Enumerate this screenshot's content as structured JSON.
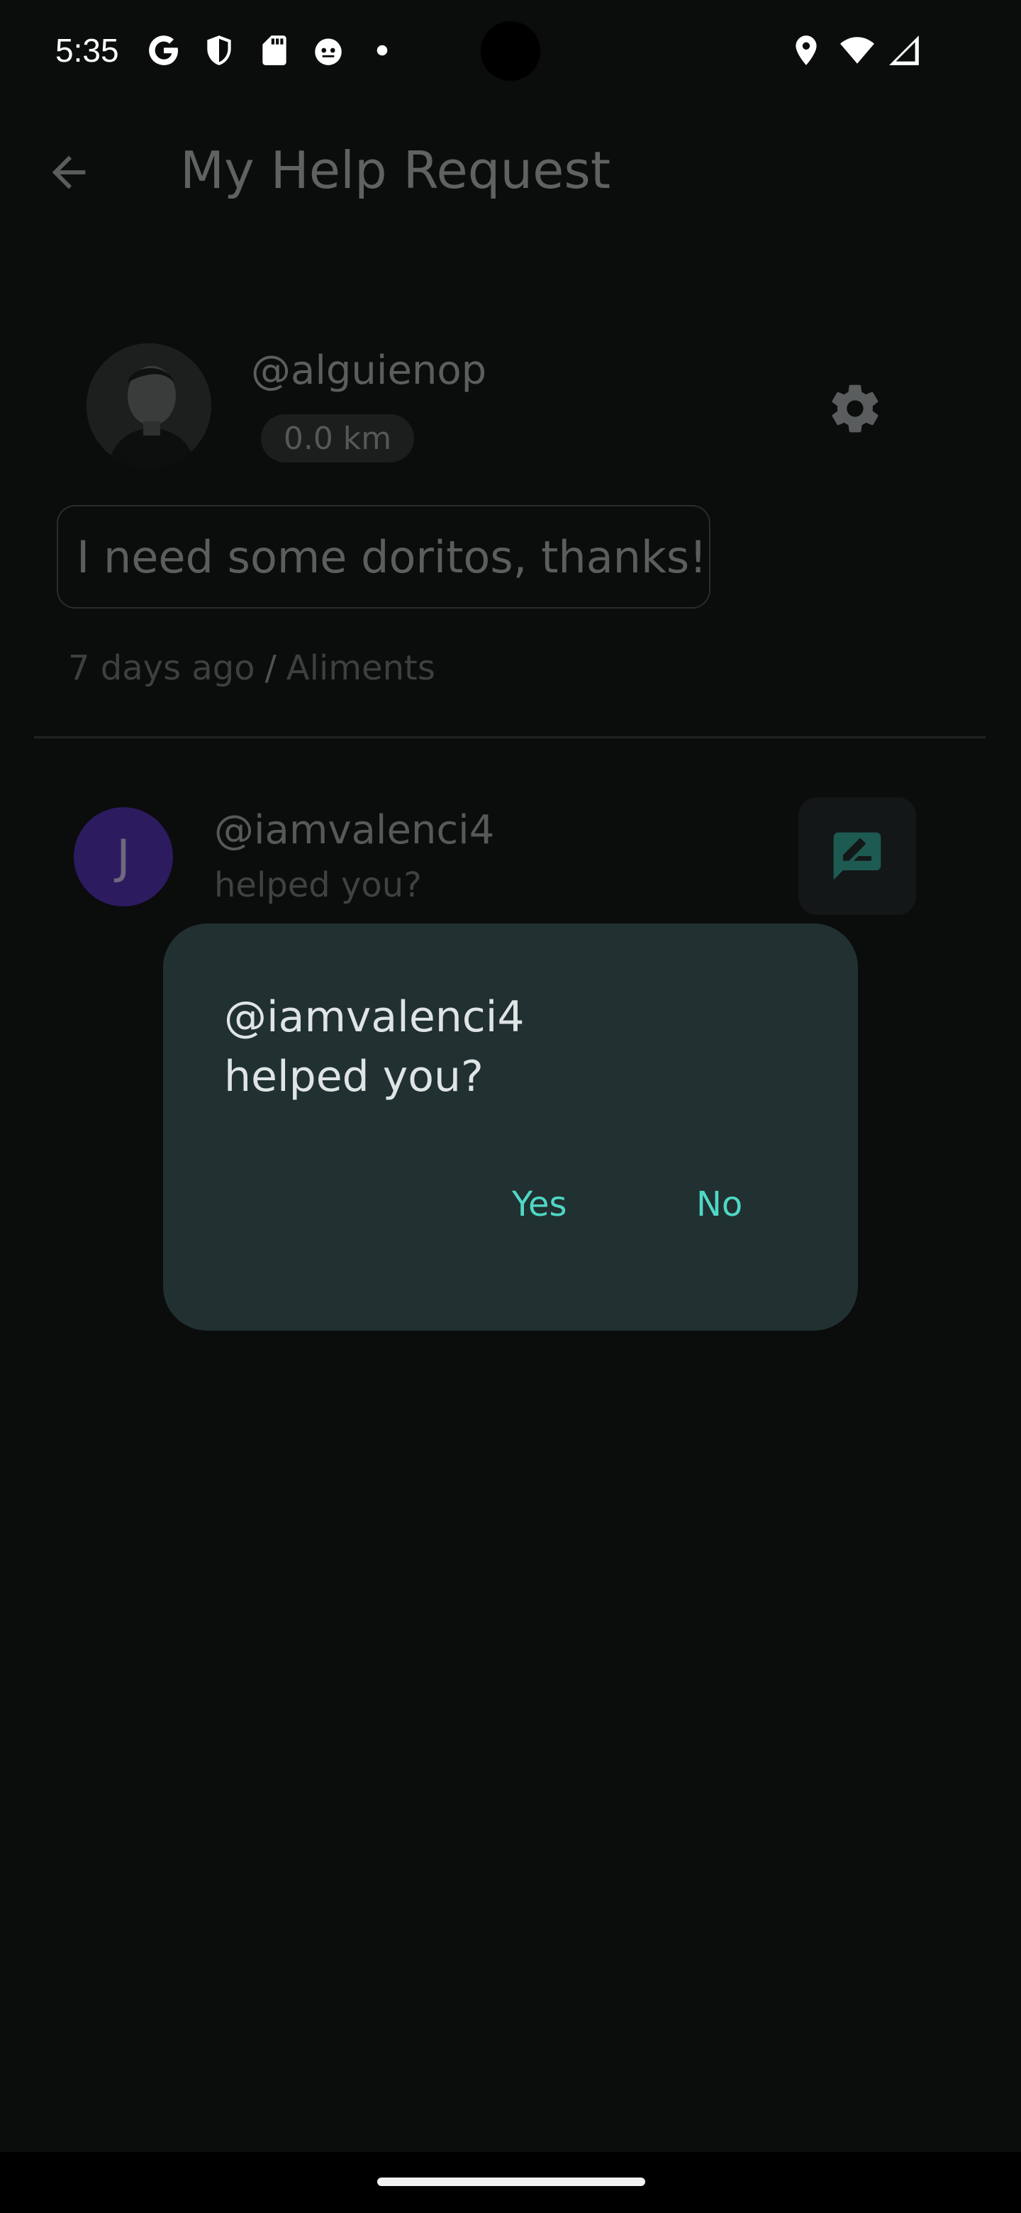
{
  "status_bar": {
    "time": "5:35",
    "left_icons": [
      "google-icon",
      "shield-icon",
      "sd-card-icon",
      "cat-icon",
      "dot-icon"
    ],
    "right_icons": [
      "location-icon",
      "wifi-icon",
      "signal-icon"
    ]
  },
  "app_bar": {
    "title": "My Help Request",
    "back_icon": "arrow-left-icon"
  },
  "request": {
    "username": "@alguienop",
    "distance": "0.0 km",
    "message": "I need some doritos, thanks!",
    "time_ago": "7 days ago",
    "separator": "/",
    "category": "Aliments",
    "settings_icon": "gear-icon"
  },
  "helper": {
    "initial": "J",
    "username": "@iamvalenci4",
    "subtitle": "helped you?",
    "action_icon": "rate-review-icon"
  },
  "dialog": {
    "line1": "@iamvalenci4",
    "line2": "helped you?",
    "yes_label": "Yes",
    "no_label": "No"
  },
  "colors": {
    "background": "#0b0c0c",
    "dialog_bg": "#213031",
    "accent": "#4fd8c5",
    "helper_avatar": "#2d1b60"
  }
}
